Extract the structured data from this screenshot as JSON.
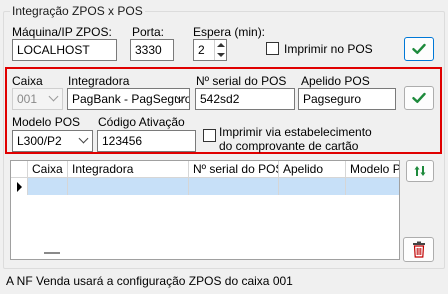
{
  "group": {
    "title": "Integração ZPOS x POS"
  },
  "top_row": {
    "machine_label": "Máquina/IP ZPOS:",
    "machine_value": "LOCALHOST",
    "port_label": "Porta:",
    "port_value": "3330",
    "wait_label": "Espera (min):",
    "wait_value": "2",
    "print_pos_label": "Imprimir no POS",
    "print_pos_checked": false
  },
  "form": {
    "caixa_label": "Caixa",
    "caixa_value": "001",
    "integradora_label": "Integradora",
    "integradora_value": "PagBank - PagSeguro",
    "serial_label": "Nº serial do POS",
    "serial_value": "542sd2",
    "apelido_label": "Apelido POS",
    "apelido_value": "Pagseguro",
    "modelo_label": "Modelo POS",
    "modelo_value": "L300/P2",
    "codigo_label": "Código Ativação",
    "codigo_value": "123456",
    "print_store_label_1": "Imprimir via estabelecimento",
    "print_store_label_2": "do comprovante de cartão",
    "print_store_checked": false
  },
  "grid": {
    "columns": [
      "Caixa",
      "Integradora",
      "Nº serial do POS",
      "Apelido",
      "Modelo PO"
    ]
  },
  "footer": {
    "text": "A NF Venda usará a configuração ZPOS do caixa 001"
  },
  "colors": {
    "accent_check": "#1e8a3c",
    "frame_red": "#e00000",
    "selected_row": "#c7e0f8"
  },
  "icons": {
    "confirm": "check-icon",
    "sort": "sort-arrows-icon",
    "delete": "trash-icon"
  }
}
